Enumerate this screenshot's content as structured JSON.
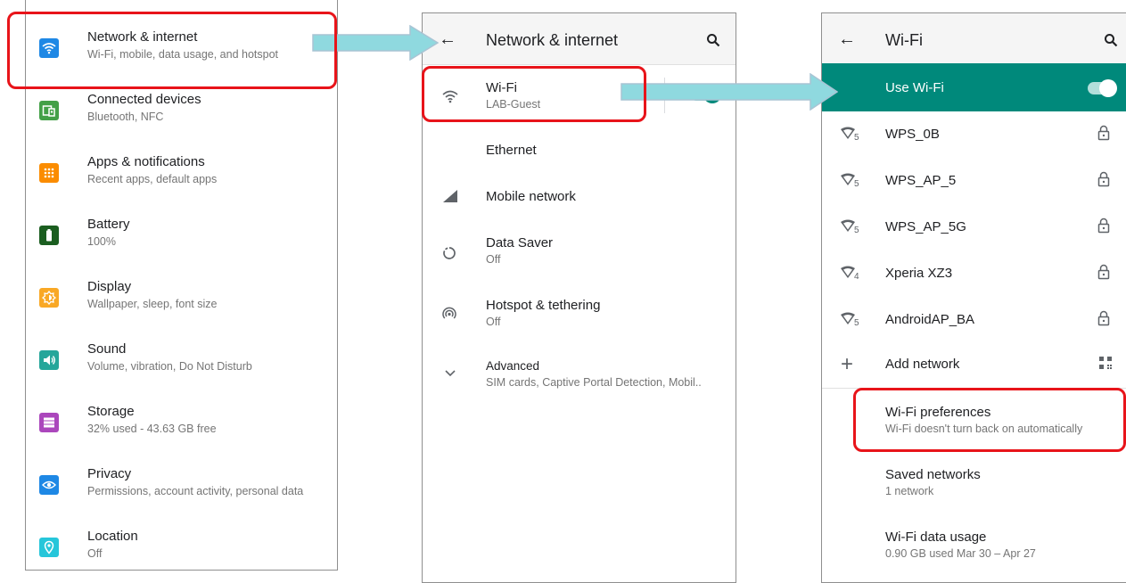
{
  "panel1": {
    "items": [
      {
        "title": "Network & internet",
        "subtitle": "Wi-Fi, mobile, data usage, and hotspot",
        "icon": "wifi-icon",
        "color": "#1e88e5"
      },
      {
        "title": "Connected devices",
        "subtitle": "Bluetooth, NFC",
        "icon": "connected-devices-icon",
        "color": "#43a047"
      },
      {
        "title": "Apps & notifications",
        "subtitle": "Recent apps, default apps",
        "icon": "apps-grid-icon",
        "color": "#fb8c00"
      },
      {
        "title": "Battery",
        "subtitle": "100%",
        "icon": "battery-icon",
        "color": "#1b5e20"
      },
      {
        "title": "Display",
        "subtitle": "Wallpaper, sleep, font size",
        "icon": "brightness-icon",
        "color": "#f9a825"
      },
      {
        "title": "Sound",
        "subtitle": "Volume, vibration, Do Not Disturb",
        "icon": "volume-icon",
        "color": "#26a69a"
      },
      {
        "title": "Storage",
        "subtitle": "32% used - 43.63 GB free",
        "icon": "storage-icon",
        "color": "#ab47bc"
      },
      {
        "title": "Privacy",
        "subtitle": "Permissions, account activity, personal data",
        "icon": "privacy-eye-icon",
        "color": "#1e88e5"
      },
      {
        "title": "Location",
        "subtitle": "Off",
        "icon": "location-pin-icon",
        "color": "#26c6da"
      }
    ]
  },
  "panel2": {
    "header": {
      "title": "Network & internet"
    },
    "items": [
      {
        "title": "Wi-Fi",
        "subtitle": "LAB-Guest",
        "icon": "wifi-outline-icon"
      },
      {
        "title": "Ethernet",
        "subtitle": "",
        "icon": ""
      },
      {
        "title": "Mobile network",
        "subtitle": "",
        "icon": "signal-icon"
      },
      {
        "title": "Data Saver",
        "subtitle": "Off",
        "icon": "data-saver-icon"
      },
      {
        "title": "Hotspot & tethering",
        "subtitle": "Off",
        "icon": "hotspot-icon"
      },
      {
        "title": "Advanced",
        "subtitle": "SIM cards, Captive Portal Detection, Mobil..",
        "icon": "chevron-down-icon"
      }
    ]
  },
  "panel3": {
    "header": {
      "title": "Wi-Fi"
    },
    "use_wifi": {
      "label": "Use Wi-Fi",
      "enabled": true,
      "bar_color": "#00897b"
    },
    "networks": [
      {
        "name": "WPS_0B",
        "band": "5"
      },
      {
        "name": "WPS_AP_5",
        "band": "5"
      },
      {
        "name": "WPS_AP_5G",
        "band": "5"
      },
      {
        "name": "Xperia XZ3",
        "band": "4"
      },
      {
        "name": "AndroidAP_BA",
        "band": "5"
      }
    ],
    "add_network": "Add network",
    "prefs": [
      {
        "title": "Wi-Fi preferences",
        "subtitle": "Wi-Fi doesn't turn back on automatically"
      },
      {
        "title": "Saved networks",
        "subtitle": "1 network"
      },
      {
        "title": "Wi-Fi data usage",
        "subtitle": "0.90 GB used Mar 30 – Apr 27"
      }
    ]
  },
  "colors": {
    "callout": "#e8141a",
    "arrow": "#8fd9df",
    "teal": "#00897b"
  }
}
